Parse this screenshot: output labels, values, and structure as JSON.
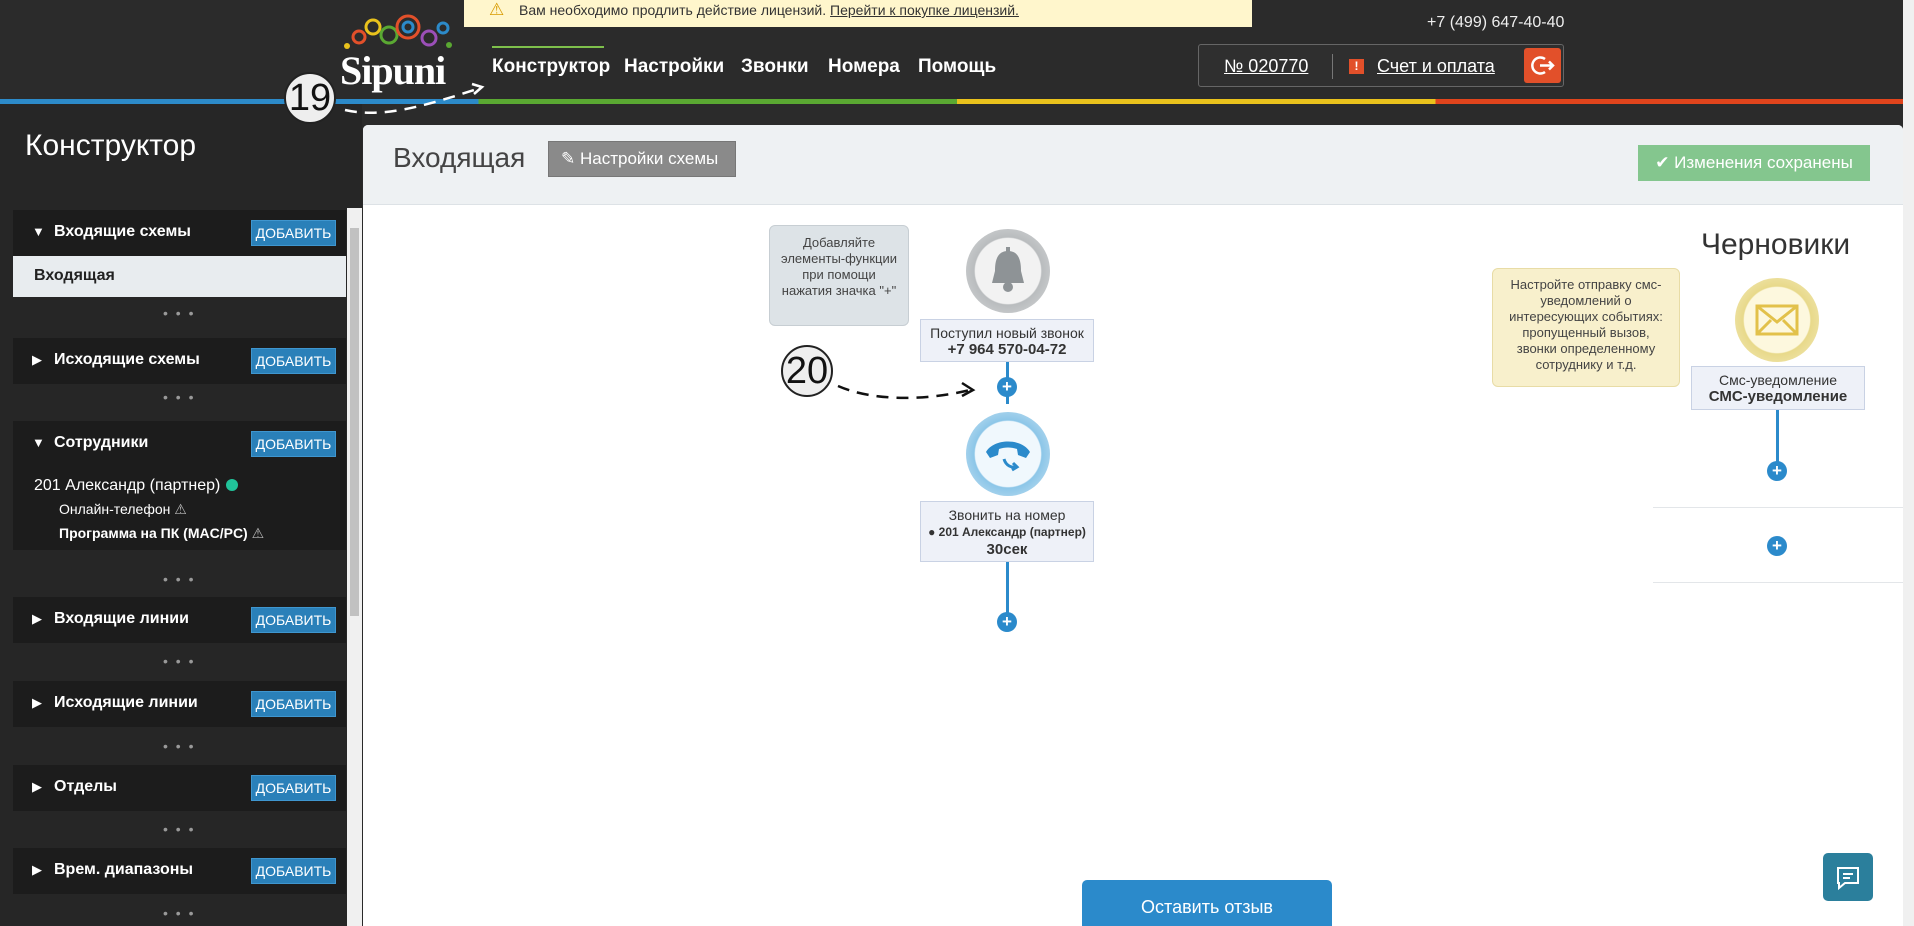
{
  "license_banner": {
    "text": "Вам необходимо продлить действие лицензий.",
    "link": "Перейти к покупке лицензий."
  },
  "header": {
    "phone": "+7 (499) 647-40-40",
    "logo_text": "Sipuni",
    "nav": [
      "Конструктор",
      "Настройки",
      "Звонки",
      "Номера",
      "Помощь"
    ],
    "account_number": "№ 020770",
    "billing_link": "Счет и оплата"
  },
  "markers": {
    "m19": "19",
    "m20": "20"
  },
  "sidebar": {
    "title": "Конструктор",
    "add_label": "ДОБАВИТЬ",
    "sections": [
      {
        "label": "Входящие схемы",
        "expanded": true
      },
      {
        "label": "Исходящие схемы",
        "expanded": false
      },
      {
        "label": "Сотрудники",
        "expanded": true
      },
      {
        "label": "Входящие линии",
        "expanded": false
      },
      {
        "label": "Исходящие линии",
        "expanded": false
      },
      {
        "label": "Отделы",
        "expanded": false
      },
      {
        "label": "Врем. диапазоны",
        "expanded": false
      }
    ],
    "incoming_selected": "Входящая",
    "employee": {
      "name": "201 Александр (партнер)",
      "device1": "Онлайн-телефон",
      "device2": "Программа на ПК (MAC/PC)"
    }
  },
  "main": {
    "title": "Входящая",
    "scheme_settings": "Настройки схемы",
    "saved": "Изменения сохранены",
    "tip_left": "Добавляйте элементы-функции при помощи нажатия значка \"+\"",
    "tip_right": "Настройте отправку смс-уведомлений о интересующих событиях: пропущенный вызов, звонки определенному сотруднику и т.д.",
    "node_incoming": {
      "label": "Поступил новый звонок",
      "value": "+7 964 570-04-72"
    },
    "node_dial": {
      "label": "Звонить на номер",
      "target": "● 201 Александр (партнер)",
      "timeout": "30сек"
    },
    "drafts_title": "Черновики",
    "node_sms": {
      "label": "Смс-уведомление",
      "value": "СМС-уведомление"
    },
    "feedback": "Оставить отзыв"
  },
  "colors": {
    "accent": "#2b8acb",
    "danger": "#e2502a",
    "saved": "#84c68e",
    "online": "#21c39a"
  }
}
